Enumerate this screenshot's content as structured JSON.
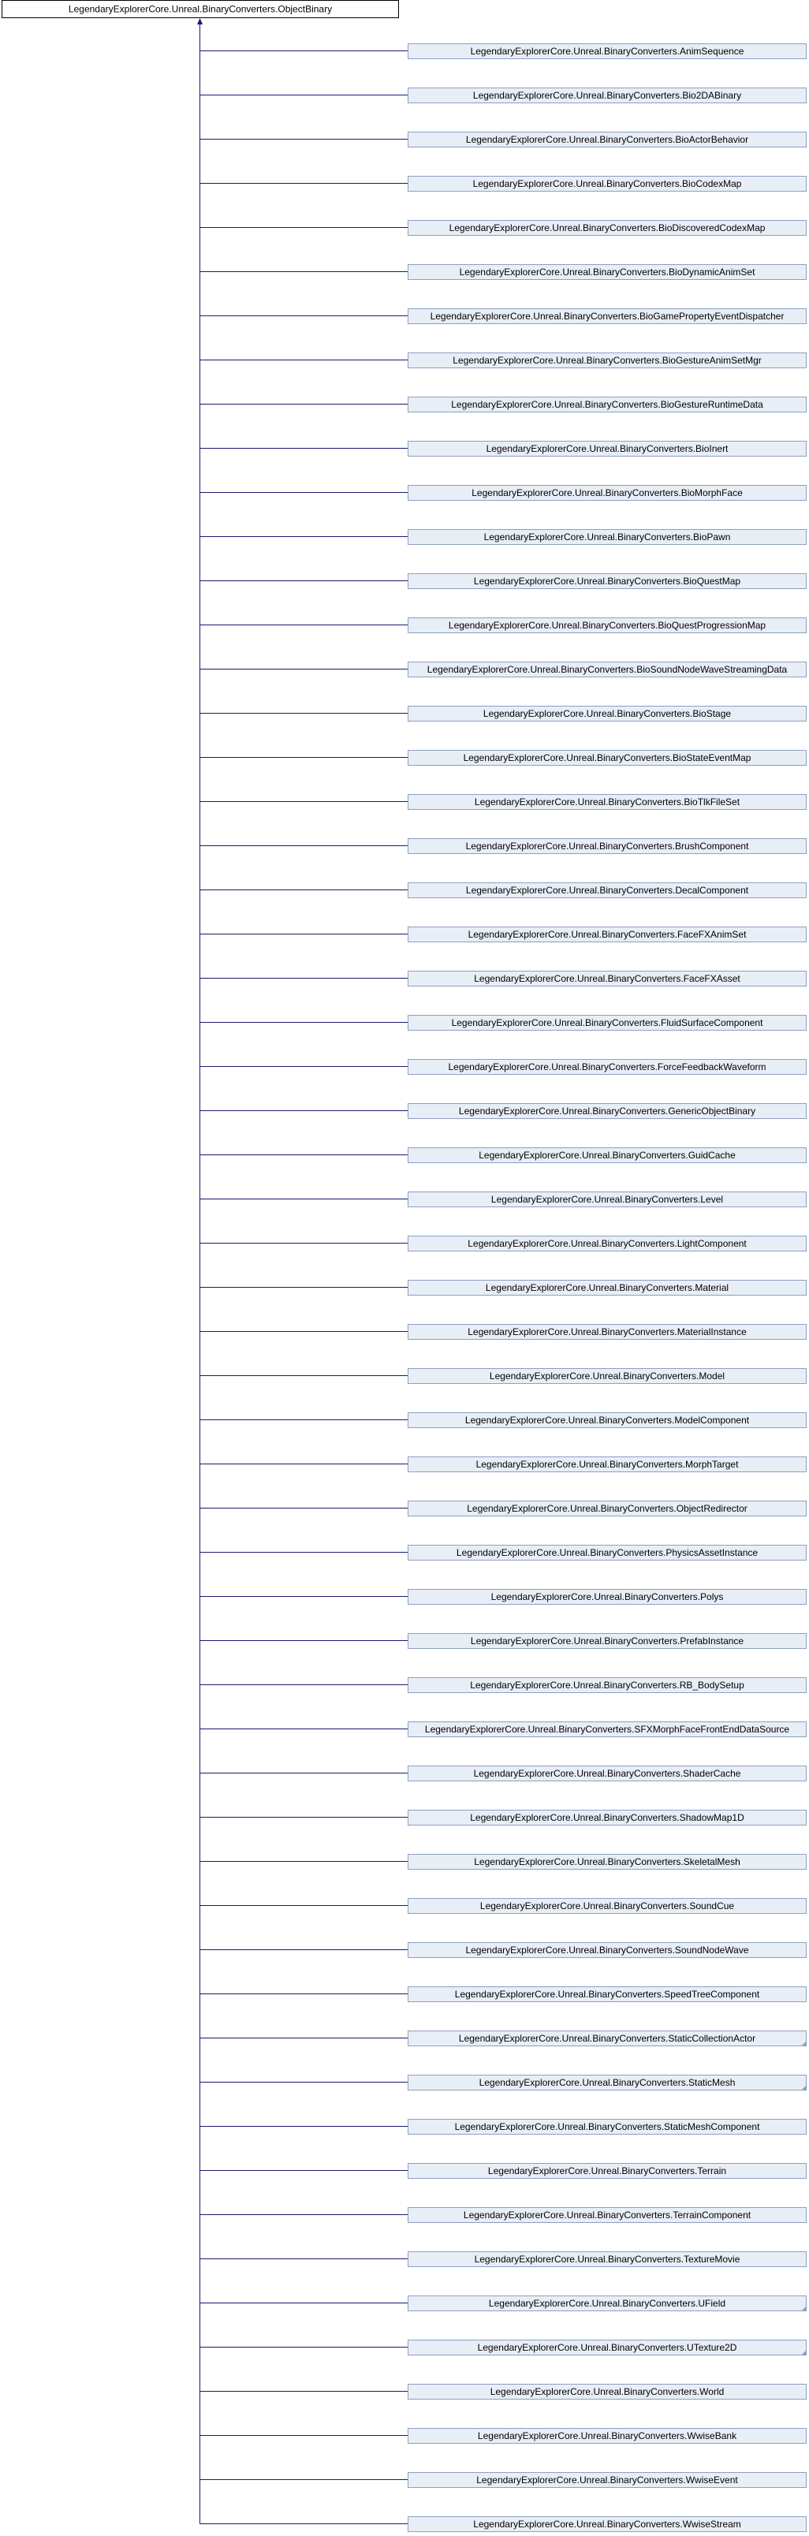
{
  "root": {
    "label": "LegendaryExplorerCore.Unreal.BinaryConverters.ObjectBinary"
  },
  "children": [
    {
      "label": "LegendaryExplorerCore.Unreal.BinaryConverters.AnimSequence"
    },
    {
      "label": "LegendaryExplorerCore.Unreal.BinaryConverters.Bio2DABinary"
    },
    {
      "label": "LegendaryExplorerCore.Unreal.BinaryConverters.BioActorBehavior"
    },
    {
      "label": "LegendaryExplorerCore.Unreal.BinaryConverters.BioCodexMap"
    },
    {
      "label": "LegendaryExplorerCore.Unreal.BinaryConverters.BioDiscoveredCodexMap"
    },
    {
      "label": "LegendaryExplorerCore.Unreal.BinaryConverters.BioDynamicAnimSet"
    },
    {
      "label": "LegendaryExplorerCore.Unreal.BinaryConverters.BioGamePropertyEventDispatcher"
    },
    {
      "label": "LegendaryExplorerCore.Unreal.BinaryConverters.BioGestureAnimSetMgr"
    },
    {
      "label": "LegendaryExplorerCore.Unreal.BinaryConverters.BioGestureRuntimeData"
    },
    {
      "label": "LegendaryExplorerCore.Unreal.BinaryConverters.BioInert"
    },
    {
      "label": "LegendaryExplorerCore.Unreal.BinaryConverters.BioMorphFace"
    },
    {
      "label": "LegendaryExplorerCore.Unreal.BinaryConverters.BioPawn"
    },
    {
      "label": "LegendaryExplorerCore.Unreal.BinaryConverters.BioQuestMap"
    },
    {
      "label": "LegendaryExplorerCore.Unreal.BinaryConverters.BioQuestProgressionMap"
    },
    {
      "label": "LegendaryExplorerCore.Unreal.BinaryConverters.BioSoundNodeWaveStreamingData"
    },
    {
      "label": "LegendaryExplorerCore.Unreal.BinaryConverters.BioStage"
    },
    {
      "label": "LegendaryExplorerCore.Unreal.BinaryConverters.BioStateEventMap"
    },
    {
      "label": "LegendaryExplorerCore.Unreal.BinaryConverters.BioTlkFileSet"
    },
    {
      "label": "LegendaryExplorerCore.Unreal.BinaryConverters.BrushComponent"
    },
    {
      "label": "LegendaryExplorerCore.Unreal.BinaryConverters.DecalComponent"
    },
    {
      "label": "LegendaryExplorerCore.Unreal.BinaryConverters.FaceFXAnimSet"
    },
    {
      "label": "LegendaryExplorerCore.Unreal.BinaryConverters.FaceFXAsset"
    },
    {
      "label": "LegendaryExplorerCore.Unreal.BinaryConverters.FluidSurfaceComponent"
    },
    {
      "label": "LegendaryExplorerCore.Unreal.BinaryConverters.ForceFeedbackWaveform"
    },
    {
      "label": "LegendaryExplorerCore.Unreal.BinaryConverters.GenericObjectBinary"
    },
    {
      "label": "LegendaryExplorerCore.Unreal.BinaryConverters.GuidCache"
    },
    {
      "label": "LegendaryExplorerCore.Unreal.BinaryConverters.Level"
    },
    {
      "label": "LegendaryExplorerCore.Unreal.BinaryConverters.LightComponent"
    },
    {
      "label": "LegendaryExplorerCore.Unreal.BinaryConverters.Material"
    },
    {
      "label": "LegendaryExplorerCore.Unreal.BinaryConverters.MaterialInstance"
    },
    {
      "label": "LegendaryExplorerCore.Unreal.BinaryConverters.Model"
    },
    {
      "label": "LegendaryExplorerCore.Unreal.BinaryConverters.ModelComponent"
    },
    {
      "label": "LegendaryExplorerCore.Unreal.BinaryConverters.MorphTarget"
    },
    {
      "label": "LegendaryExplorerCore.Unreal.BinaryConverters.ObjectRedirector"
    },
    {
      "label": "LegendaryExplorerCore.Unreal.BinaryConverters.PhysicsAssetInstance"
    },
    {
      "label": "LegendaryExplorerCore.Unreal.BinaryConverters.Polys"
    },
    {
      "label": "LegendaryExplorerCore.Unreal.BinaryConverters.PrefabInstance"
    },
    {
      "label": "LegendaryExplorerCore.Unreal.BinaryConverters.RB_BodySetup"
    },
    {
      "label": "LegendaryExplorerCore.Unreal.BinaryConverters.SFXMorphFaceFrontEndDataSource"
    },
    {
      "label": "LegendaryExplorerCore.Unreal.BinaryConverters.ShaderCache"
    },
    {
      "label": "LegendaryExplorerCore.Unreal.BinaryConverters.ShadowMap1D"
    },
    {
      "label": "LegendaryExplorerCore.Unreal.BinaryConverters.SkeletalMesh"
    },
    {
      "label": "LegendaryExplorerCore.Unreal.BinaryConverters.SoundCue"
    },
    {
      "label": "LegendaryExplorerCore.Unreal.BinaryConverters.SoundNodeWave"
    },
    {
      "label": "LegendaryExplorerCore.Unreal.BinaryConverters.SpeedTreeComponent"
    },
    {
      "label": "LegendaryExplorerCore.Unreal.BinaryConverters.StaticCollectionActor",
      "has_more": true
    },
    {
      "label": "LegendaryExplorerCore.Unreal.BinaryConverters.StaticMesh",
      "has_more": true
    },
    {
      "label": "LegendaryExplorerCore.Unreal.BinaryConverters.StaticMeshComponent"
    },
    {
      "label": "LegendaryExplorerCore.Unreal.BinaryConverters.Terrain"
    },
    {
      "label": "LegendaryExplorerCore.Unreal.BinaryConverters.TerrainComponent"
    },
    {
      "label": "LegendaryExplorerCore.Unreal.BinaryConverters.TextureMovie"
    },
    {
      "label": "LegendaryExplorerCore.Unreal.BinaryConverters.UField",
      "has_more": true
    },
    {
      "label": "LegendaryExplorerCore.Unreal.BinaryConverters.UTexture2D",
      "has_more": true
    },
    {
      "label": "LegendaryExplorerCore.Unreal.BinaryConverters.World"
    },
    {
      "label": "LegendaryExplorerCore.Unreal.BinaryConverters.WwiseBank"
    },
    {
      "label": "LegendaryExplorerCore.Unreal.BinaryConverters.WwiseEvent"
    },
    {
      "label": "LegendaryExplorerCore.Unreal.BinaryConverters.WwiseStream"
    }
  ],
  "colors": {
    "edge": "#191970",
    "child_fill": "#e8eef6",
    "child_border": "#8e9ec2",
    "root_fill": "#ffffff",
    "root_border": "#000000"
  }
}
